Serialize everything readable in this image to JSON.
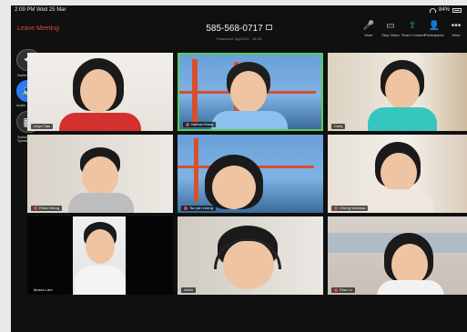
{
  "status": {
    "time_date": "2:09 PM  Wed 25 Mar",
    "battery": "84%"
  },
  "meeting": {
    "leave": "Leave Meeting",
    "id": "585-568-0717",
    "password": "Password: upg0101 · 14:28"
  },
  "controls": [
    {
      "name": "mute",
      "label": "Mute",
      "icon": "mic-icon",
      "symbol": "🎤"
    },
    {
      "name": "stop-video",
      "label": "Stop Video",
      "icon": "video-icon",
      "symbol": "▭"
    },
    {
      "name": "share-content",
      "label": "Share Content",
      "icon": "share-icon",
      "symbol": "⇧"
    },
    {
      "name": "participants",
      "label": "Participants",
      "icon": "people-icon",
      "symbol": "👤"
    },
    {
      "name": "more",
      "label": "More",
      "icon": "more-icon",
      "symbol": "•••"
    }
  ],
  "left_tools": [
    {
      "label": "Switch Camera"
    },
    {
      "label": "Audio"
    },
    {
      "label": "Switch to Active Speaker"
    }
  ],
  "participants": [
    {
      "name": "Linyu Tian",
      "muted": false,
      "active": false
    },
    {
      "name": "Nathan Wong",
      "muted": true,
      "active": true
    },
    {
      "name": "Carly",
      "muted": false,
      "active": false
    },
    {
      "name": "Ethan Wong",
      "muted": true,
      "active": false
    },
    {
      "name": "Tsz yan Leung",
      "muted": true,
      "active": false
    },
    {
      "name": "Cheng Vanessa",
      "muted": true,
      "active": false
    },
    {
      "name": "Moses Lam",
      "muted": false,
      "active": false
    },
    {
      "name": "Aiden",
      "muted": false,
      "active": false
    },
    {
      "name": "Elise Lo",
      "muted": true,
      "active": false
    }
  ]
}
